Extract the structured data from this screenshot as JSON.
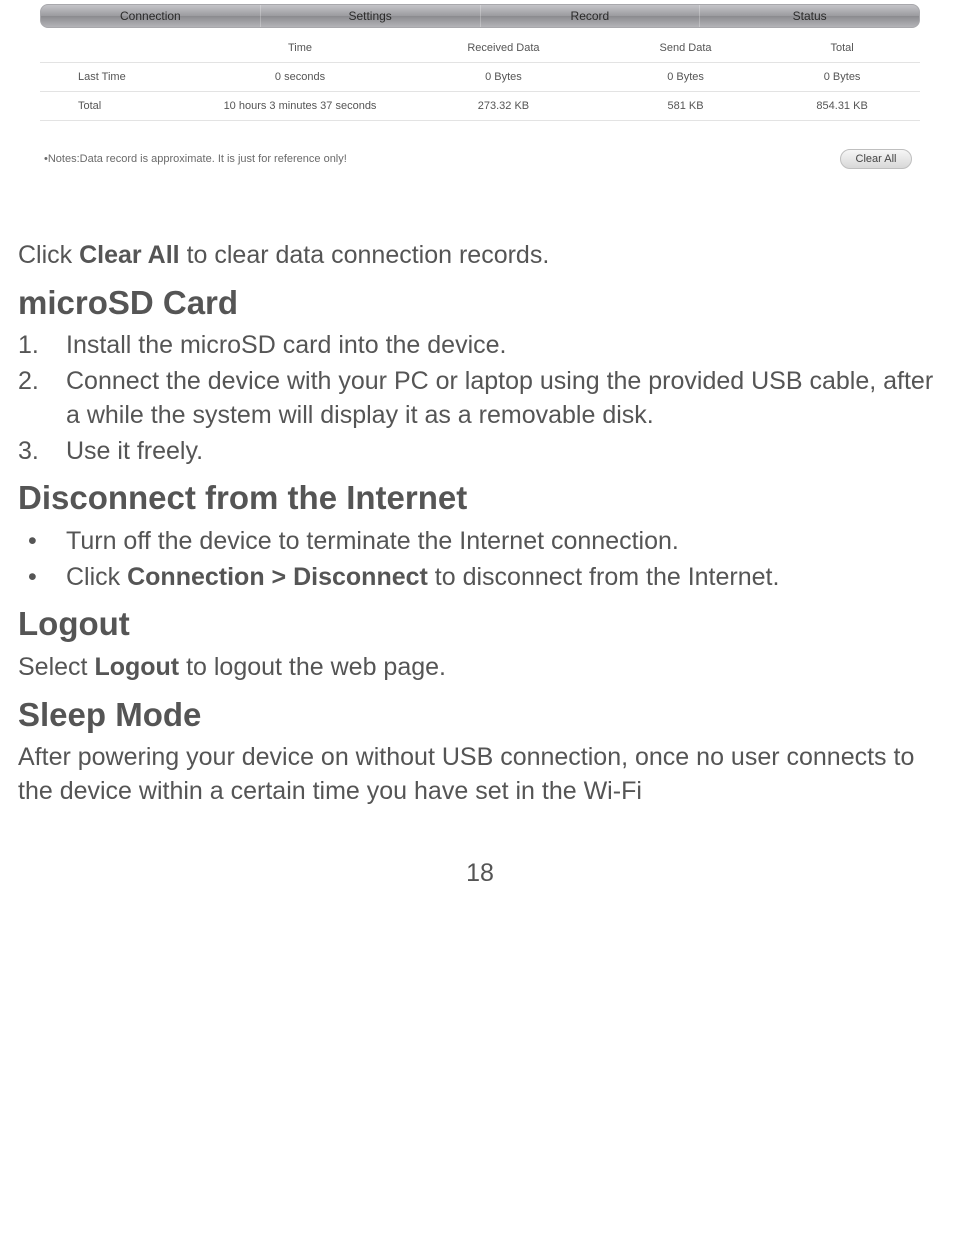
{
  "figure": {
    "tabs": [
      "Connection",
      "Settings",
      "Record",
      "Status"
    ],
    "headers": [
      "",
      "Time",
      "Received Data",
      "Send Data",
      "Total"
    ],
    "rows": [
      {
        "label": "Last Time",
        "time": "0 seconds",
        "recv": "0 Bytes",
        "send": "0 Bytes",
        "total": "0 Bytes"
      },
      {
        "label": "Total",
        "time": "10 hours 3 minutes 37 seconds",
        "recv": "273.32 KB",
        "send": "581 KB",
        "total": "854.31 KB"
      }
    ],
    "notes": "•Notes:Data record is approximate. It is just for reference only!",
    "clear_button": "Clear All"
  },
  "body": {
    "p1_prefix": "Click ",
    "p1_bold": "Clear All",
    "p1_suffix": " to clear data connection records.",
    "h_microsd": "microSD Card",
    "ol": [
      "Install the microSD card into the device.",
      "Connect the device with your PC or laptop using the provided USB cable, after a while the system will display it as a removable disk.",
      "Use it freely."
    ],
    "h_disconnect": "Disconnect from the Internet",
    "ul": {
      "item1": "Turn off the device to terminate the Internet connection.",
      "item2_prefix": "Click ",
      "item2_bold": "Connection > Disconnect",
      "item2_suffix": " to disconnect from the Internet."
    },
    "h_logout": "Logout",
    "logout_p_prefix": "Select ",
    "logout_p_bold": "Logout",
    "logout_p_suffix": " to logout the web page.",
    "h_sleep": "Sleep Mode",
    "sleep_p": "After powering your device on without USB connection, once no user connects to the device within a certain time you have set in the Wi-Fi"
  },
  "page_number": "18",
  "ol_numbers": [
    "1.",
    "2.",
    "3."
  ],
  "bullet": "•"
}
